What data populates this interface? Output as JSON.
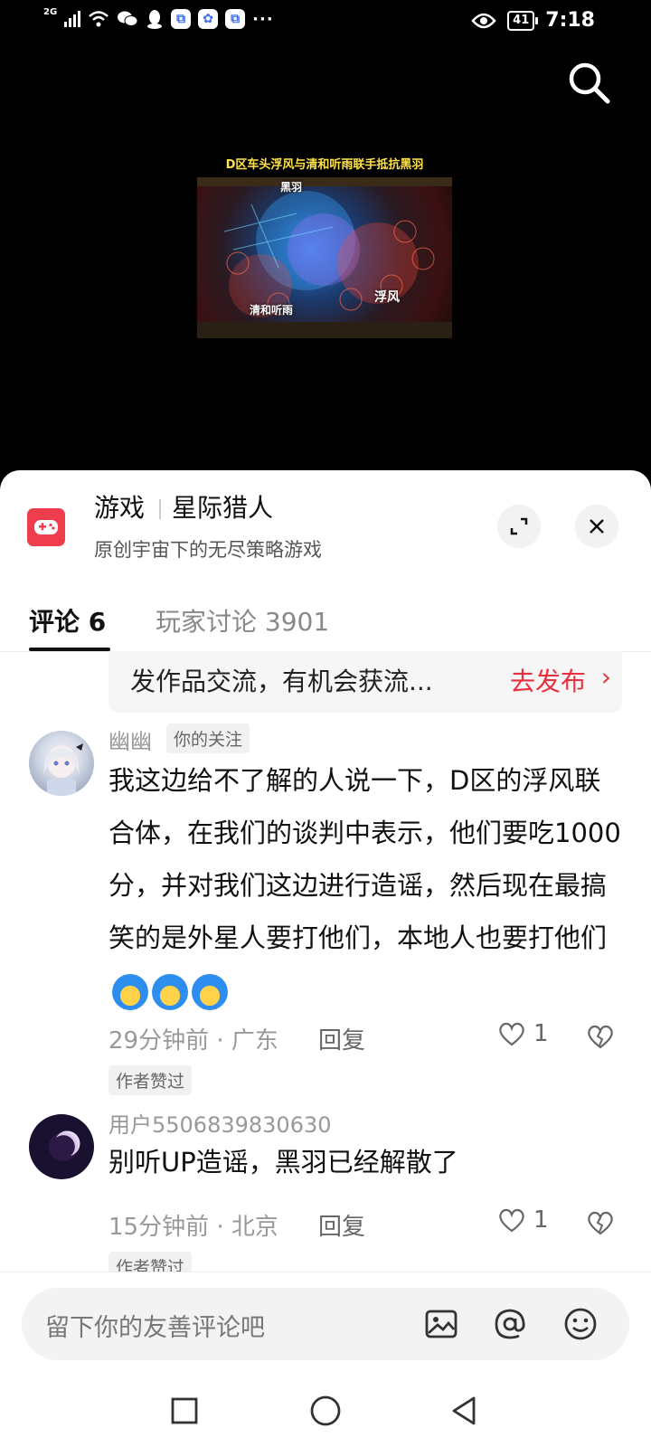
{
  "status_bar": {
    "network": "2G",
    "more": "···",
    "battery": "41",
    "time": "7:18"
  },
  "video": {
    "caption": "D区车头浮风与清和听雨联手抵抗黑羽",
    "label_top": "黑羽",
    "label_left": "清和听雨",
    "label_right": "浮风"
  },
  "game_card": {
    "category": "游戏",
    "name": "星际猎人",
    "subtitle": "原创宇宙下的无尽策略游戏"
  },
  "tabs": {
    "comments": "评论 6",
    "discussion": "玩家讨论 3901"
  },
  "banner": {
    "text": "发作品交流，有机会获流...",
    "link": "去发布",
    "arrow": "›"
  },
  "comments": [
    {
      "user": "幽幽",
      "badge": "你的关注",
      "text": "我这边给不了解的人说一下，D区的浮风联合体，在我们的谈判中表示，他们要吃1000分，并对我们这边进行造谣，然后现在最搞笑的是外星人要打他们，本地人也要打他们",
      "meta": "29分钟前 · 广东",
      "reply": "回复",
      "likes": "1",
      "author_tag": "作者赞过"
    },
    {
      "user": "用户5506839830630",
      "text": "别听UP造谣，黑羽已经解散了",
      "meta": "15分钟前 · 北京",
      "reply": "回复",
      "likes": "1",
      "author_tag": "作者赞过"
    }
  ],
  "input": {
    "placeholder": "留下你的友善评论吧"
  },
  "colors": {
    "accent": "#e8303f",
    "game_icon": "#ee3e4e"
  }
}
